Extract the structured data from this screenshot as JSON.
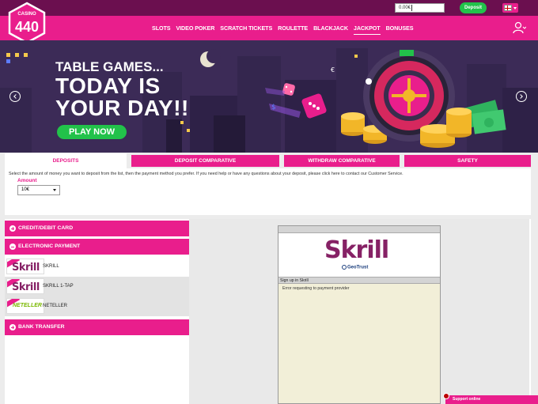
{
  "topbar": {
    "balance": "0.00€",
    "deposit_label": "Deposit"
  },
  "header": {
    "logo_top": "CASINO",
    "logo_number": "440",
    "nav": [
      "SLOTS",
      "VIDEO POKER",
      "SCRATCH TICKETS",
      "ROULETTE",
      "BLACKJACK",
      "JACKPOT",
      "BONUSES"
    ],
    "active_nav": "JACKPOT"
  },
  "banner": {
    "line1": "TABLE GAMES...",
    "line2": "TODAY IS",
    "line3": "YOUR DAY!!",
    "cta": "PLAY NOW"
  },
  "tabs": [
    "DEPOSITS",
    "DEPOSIT COMPARATIVE",
    "WITHDRAW COMPARATIVE",
    "SAFETY"
  ],
  "deposit": {
    "instructions": "Select the amount of money you want to deposit from the list, then the payment method you prefer. If you need help or have any questions about your deposit, please click here to contact our Customer Service.",
    "amount_label": "Amount",
    "amount_value": "10€"
  },
  "categories": {
    "card": "CREDIT/DEBIT CARD",
    "electronic": "ELECTRONIC PAYMENT",
    "bank": "BANK TRANSFER"
  },
  "methods": [
    {
      "name": "SKRILL",
      "logo": "Skrill"
    },
    {
      "name": "SKRILL 1-TAP",
      "logo": "Skrill"
    },
    {
      "name": "NETELLER",
      "logo": "NETELLER"
    }
  ],
  "frame": {
    "logo": "Skrill",
    "geotrust": "GeoTrust",
    "signup": "Sign up in Skrill",
    "message": "Error requesting to payment provider"
  },
  "support": {
    "label": "Support online"
  },
  "colors": {
    "brand_pink": "#e91e8c",
    "top_strip": "#6b0f4f",
    "green": "#22c24a",
    "skrill_purple": "#862165"
  }
}
